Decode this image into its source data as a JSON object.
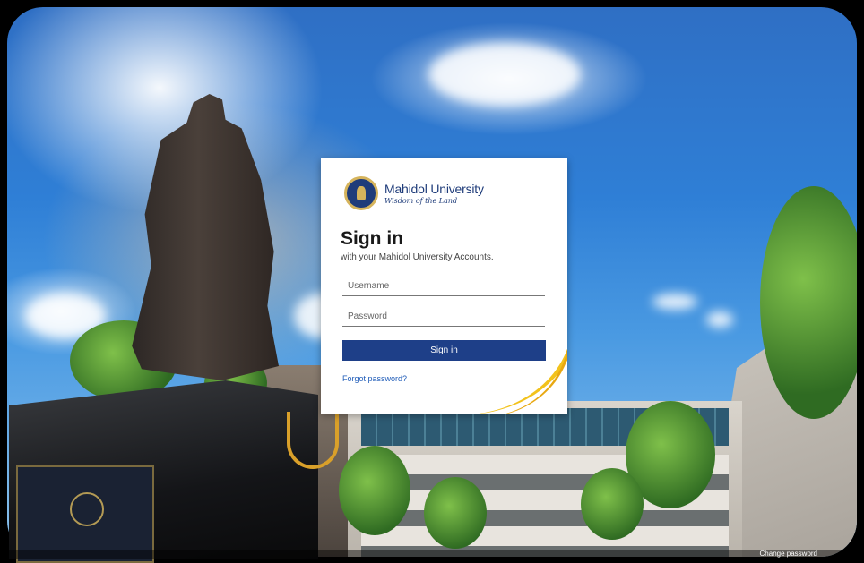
{
  "brand": {
    "name": "Mahidol University",
    "tagline": "Wisdom of the Land",
    "primary_color": "#1e3f88",
    "accent_color": "#f2c21c"
  },
  "login": {
    "title": "Sign in",
    "subtitle": "with your Mahidol University Accounts.",
    "username_placeholder": "Username",
    "password_placeholder": "Password",
    "submit_label": "Sign in",
    "forgot_label": "Forgot password?"
  },
  "footer": {
    "change_password_label": "Change password"
  }
}
